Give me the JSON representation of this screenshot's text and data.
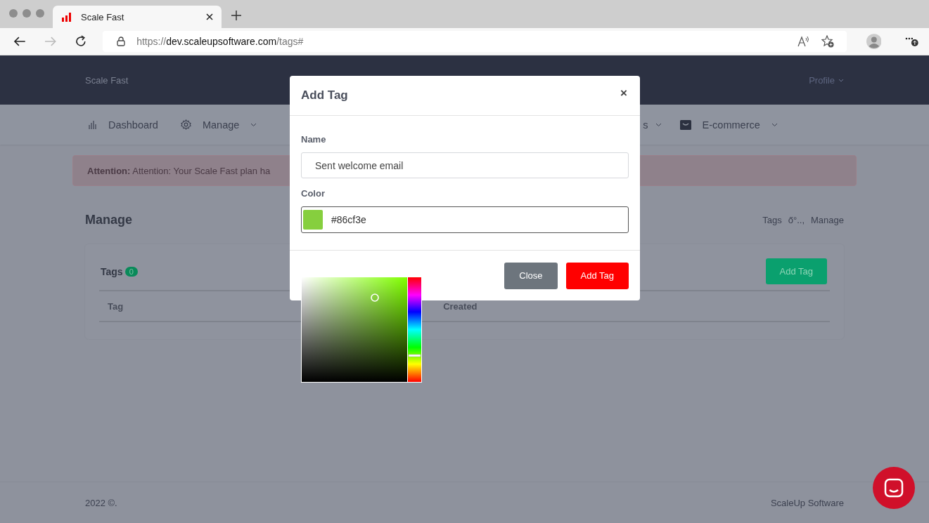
{
  "browser": {
    "tab": {
      "title": "Scale Fast"
    },
    "url": {
      "scheme": "https://",
      "host": "dev.scaleupsoftware.com",
      "path": "/tags#"
    }
  },
  "navbar": {
    "brand": "Scale Fast",
    "profile": "Profile"
  },
  "menu": [
    {
      "label": "Dashboard",
      "kind": "chart",
      "dropdown": false
    },
    {
      "label": "Manage",
      "kind": "gear",
      "dropdown": true
    },
    {
      "label": "s",
      "kind": "none",
      "dropdown": true
    },
    {
      "label": "E-commerce",
      "kind": "bag",
      "dropdown": true
    }
  ],
  "alert": {
    "text": "**Attention:** Attention: Your Scale Fast plan ha"
  },
  "page": {
    "title": "Manage",
    "breadcrumb": [
      {
        "label": "Tags"
      },
      {
        "label": "ő°..,"
      },
      {
        "label": "Manage"
      }
    ]
  },
  "card": {
    "title": "Tags",
    "count": "0",
    "add_button": "Add Tag",
    "columns": [
      "Tag",
      "Created"
    ]
  },
  "footer": {
    "left": "2022 ©.",
    "right": "ScaleUp Software"
  },
  "modal": {
    "title": "Add Tag",
    "close": "×",
    "fields": [
      {
        "label": "Name",
        "value": "Sent welcome email",
        "kind": "text"
      },
      {
        "label": "Color",
        "value": "#86cf3e",
        "kind": "color"
      }
    ],
    "buttons": [
      {
        "label": "Close",
        "kind": "secondary"
      },
      {
        "label": "Add Tag",
        "kind": "primary"
      }
    ]
  }
}
